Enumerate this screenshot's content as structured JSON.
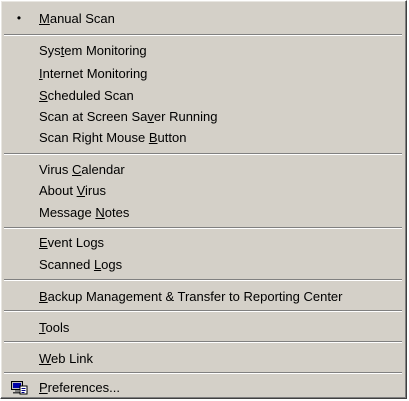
{
  "menu": {
    "manual_scan": {
      "pre": "",
      "key": "M",
      "post": "anual Scan",
      "checked_mark": "•"
    },
    "system_monitoring": {
      "pre": "Sys",
      "key": "t",
      "post": "em Monitoring"
    },
    "internet_monitoring": {
      "pre": "",
      "key": "I",
      "post": "nternet Monitoring"
    },
    "scheduled_scan": {
      "pre": "",
      "key": "S",
      "post": "cheduled Scan"
    },
    "screen_saver_scan": {
      "pre": "Scan at Screen Sa",
      "key": "v",
      "post": "er Running"
    },
    "right_mouse_scan": {
      "pre": "Scan Right Mouse ",
      "key": "B",
      "post": "utton"
    },
    "virus_calendar": {
      "pre": "Virus ",
      "key": "C",
      "post": "alendar"
    },
    "about_virus": {
      "pre": "About ",
      "key": "V",
      "post": "irus"
    },
    "message_notes": {
      "pre": "Message ",
      "key": "N",
      "post": "otes"
    },
    "event_logs": {
      "pre": "",
      "key": "E",
      "post": "vent Logs"
    },
    "scanned_logs": {
      "pre": "Scanned ",
      "key": "L",
      "post": "ogs"
    },
    "backup_management": {
      "pre": "",
      "key": "B",
      "post": "ackup Management & Transfer to Reporting Center"
    },
    "tools": {
      "pre": "",
      "key": "T",
      "post": "ools"
    },
    "web_link": {
      "pre": "",
      "key": "W",
      "post": "eb Link"
    },
    "preferences": {
      "pre": "",
      "key": "P",
      "post": "references..."
    }
  },
  "icons": {
    "checked_mark": "bullet",
    "preferences_icon": "preferences-icon"
  }
}
